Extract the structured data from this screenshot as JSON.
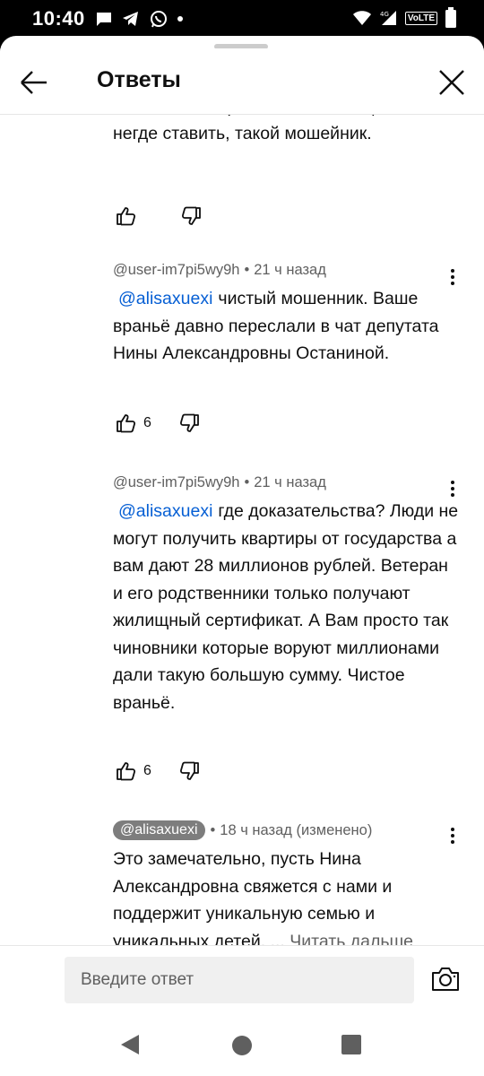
{
  "status_bar": {
    "time": "10:40",
    "network": "4G",
    "volte": "VoLTE"
  },
  "header": {
    "title": "Ответы"
  },
  "previous_comment": {
    "lines": "мнению хейтеров на мне вообще клейма негде ставить, такой мошейник."
  },
  "comments": [
    {
      "author": "@user-im7pi5wy9h",
      "time": "21 ч назад",
      "mention": "@alisaxuexi",
      "text": "чистый мошенник. Ваше враньё давно переслали в чат депутата Нины Александровны Останиной.",
      "likes": "6"
    },
    {
      "author": "@user-im7pi5wy9h",
      "time": "21 ч назад",
      "mention": "@alisaxuexi",
      "text": "где доказательства? Люди не могут получить квартиры от государства а вам дают 28 миллионов рублей. Ветеран и его родственники только получают жилищный сертификат. А Вам просто так чиновники которые воруют миллионами дали такую большую сумму. Чистое враньё.",
      "likes": "6"
    },
    {
      "author": "@alisaxuexi",
      "time": "18 ч назад (изменено)",
      "text": "Это замечательно, пусть Нина Александровна свяжется с нами и поддержит уникальную семью и уникальных детей. ...",
      "read_more": "Читать дальше"
    }
  ],
  "reply_input": {
    "placeholder": "Введите ответ"
  },
  "colors": {
    "mention": "#065fd4",
    "secondary_text": "#606060",
    "author_chip": "#7d7d7d"
  },
  "icons": [
    "message-icon",
    "telegram-icon",
    "whatsapp-icon",
    "wifi-icon",
    "signal-icon",
    "battery-icon",
    "back-arrow-icon",
    "close-icon",
    "thumbs-up-icon",
    "thumbs-down-icon",
    "more-vert-icon",
    "camera-icon"
  ]
}
